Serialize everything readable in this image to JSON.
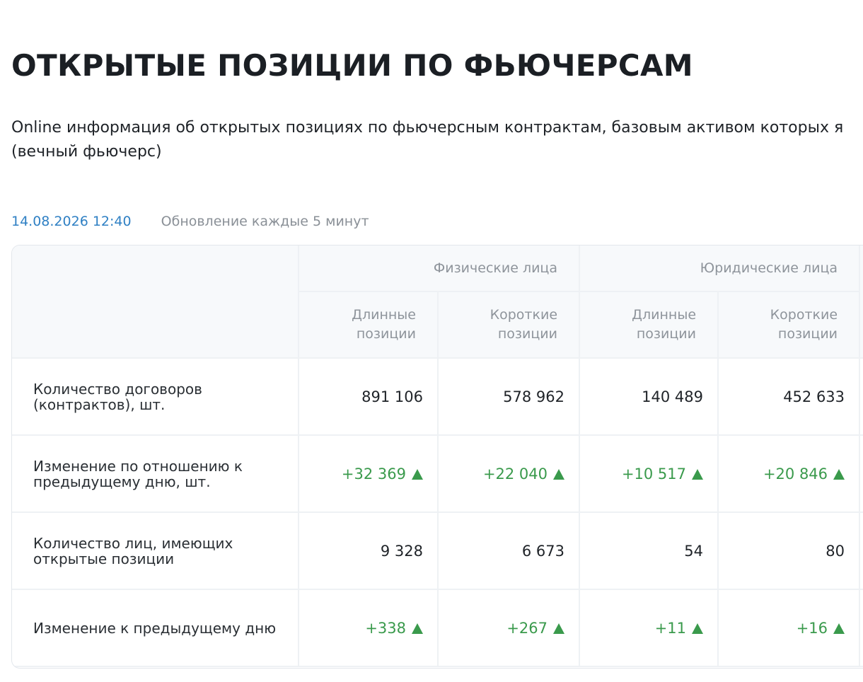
{
  "page": {
    "title": "ОТКРЫТЫЕ ПОЗИЦИИ ПО ФЬЮЧЕРСАМ",
    "description_line1": "Online информация об открытых позициях по фьючерсным контрактам, базовым активом которых я",
    "description_line2": "(вечный фьючерс)",
    "date": "14.08.2026 12:40",
    "update_note": "Обновление каждые 5 минут"
  },
  "table": {
    "groups": [
      "Физические лица",
      "Юридические лица"
    ],
    "subheaders": [
      "Длинные позиции",
      "Короткие позиции",
      "Длинные позиции",
      "Короткие позиции"
    ],
    "rows": [
      {
        "label": "Количество договоров (контрактов), шт.",
        "values": [
          "891 106",
          "578 962",
          "140 489",
          "452 633"
        ],
        "change": false
      },
      {
        "label": "Изменение по отношению к предыдущему дню, шт.",
        "values": [
          "+32 369",
          "+22 040",
          "+10 517",
          "+20 846"
        ],
        "change": true
      },
      {
        "label": "Количество лиц, имеющих открытые позиции",
        "values": [
          "9 328",
          "6 673",
          "54",
          "80"
        ],
        "change": false
      },
      {
        "label": "Изменение к предыдущему дню",
        "values": [
          "+338",
          "+267",
          "+11",
          "+16"
        ],
        "change": true
      }
    ]
  },
  "colors": {
    "positive": "#3a9a4c",
    "date_link": "#2f80c4",
    "header_bg": "#f7f9fb"
  },
  "icons": {
    "increase": "triangle-up-icon"
  }
}
